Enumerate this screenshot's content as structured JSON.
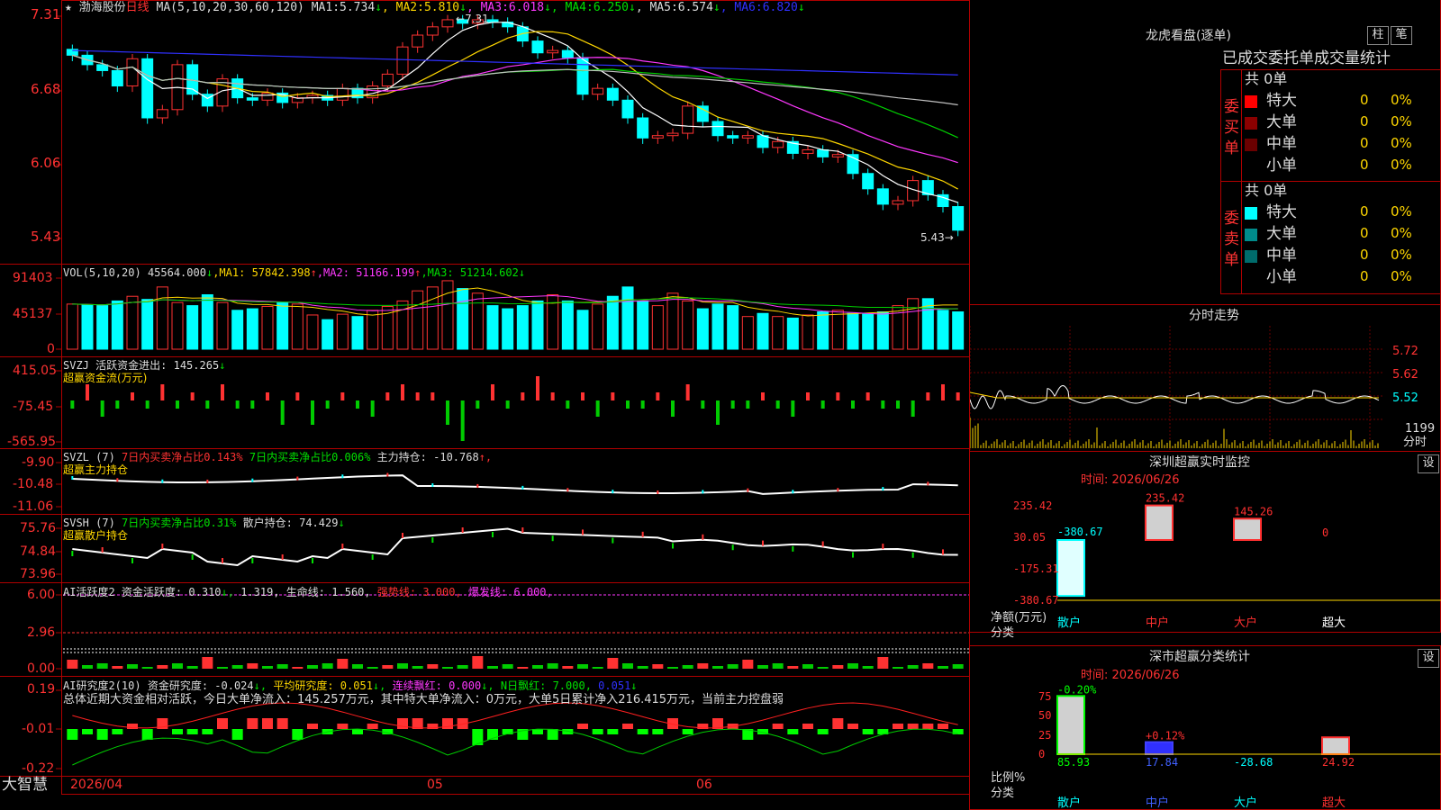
{
  "colors": {
    "up": "#ff3232",
    "down": "#00ffff",
    "ma1": "#ffffff",
    "ma2": "#ffd700",
    "ma3": "#ff38ff",
    "ma4": "#00d000",
    "ma5": "#c0c0c0",
    "ma6": "#3030ff",
    "grid": "#b00000",
    "bg": "#000000"
  },
  "title": {
    "star": "★",
    "name": "渤海股份",
    "period": "日线",
    "ma_label": "MA(5,10,20,30,60,120)",
    "ma": [
      {
        "k": "MA1:",
        "v": "5.734",
        "a": "↓"
      },
      {
        "k": "MA2:",
        "v": "5.810",
        "a": "↓"
      },
      {
        "k": "MA3:",
        "v": "6.018",
        "a": "↓"
      },
      {
        "k": "MA4:",
        "v": "6.250",
        "a": "↓"
      },
      {
        "k": "MA5:",
        "v": "6.574",
        "a": "↓"
      },
      {
        "k": "MA6:",
        "v": "6.820",
        "a": "↓"
      }
    ]
  },
  "price_axis": [
    "7.31",
    "6.68",
    "6.06",
    "5.43"
  ],
  "price_marks": {
    "high": "7.31",
    "low": "5.43"
  },
  "vol": {
    "label": "VOL(5,10,20)",
    "v": "45564.000",
    "a": "↓",
    "ma1": "57842.398",
    "ma2": "51166.199",
    "ma3": "51214.602",
    "axis": [
      "91403",
      "45137",
      "0"
    ]
  },
  "svzj": {
    "label": "SVZJ",
    "name": "活跃资金进出:",
    "v": "145.265",
    "a": "↓",
    "sub": "超赢资金流(万元)",
    "axis": [
      "415.05",
      "-75.45",
      "-565.95"
    ]
  },
  "svzl": {
    "label": "SVZL (7)",
    "t1": "7日内买卖净占比0.143%",
    "t2": "7日内买卖净占比0.006%",
    "t3": "主力持仓:",
    "v": "-10.768",
    "a": "↑,",
    "sub": "超赢主力持仓",
    "axis": [
      "-9.90",
      "-10.48",
      "-11.06"
    ]
  },
  "svsh": {
    "label": "SVSH (7)",
    "t1": "7日内买卖净占比0.31%",
    "t3": "散户持仓:",
    "v": "74.429",
    "a": "↓",
    "sub": "超赢散户持仓",
    "axis": [
      "75.76",
      "74.84",
      "73.96"
    ]
  },
  "ai1": {
    "label": "AI活跃度2",
    "t1": "资金活跃度:",
    "v1": "0.310",
    "a1": "↓,",
    "v2": "1.319,",
    "t2": "生命线:",
    "v3": "1.560,",
    "t3": "强势线:",
    "v4": "3.000,",
    "t4": "爆发线:",
    "v5": "6.000,",
    "axis": [
      "6.00",
      "2.96",
      "0.00"
    ]
  },
  "ai2": {
    "label": "AI研究度2(10)",
    "t1": "资金研究度:",
    "v1": "-0.024",
    "a1": "↓,",
    "t2": "平均研究度:",
    "v2": "0.051",
    "a2": "↓,",
    "t3": "连续飘红:",
    "v3": "0.000",
    "a3": "↓,",
    "t4": "N日飘红:",
    "v4": "7.000,",
    "v5": "0.051",
    "a5": "↓",
    "summary": "总体近期大资金相对活跃，今日大单净流入：145.257万元，其中特大单净流入：0万元，大单5日累计净入216.415万元，当前主力控盘弱",
    "axis": [
      "0.19",
      "-0.01",
      "-0.22"
    ]
  },
  "xaxis": [
    "2026/04",
    "05",
    "06"
  ],
  "brand": "大智慧",
  "dragon": {
    "title": "龙虎看盘(逐单)",
    "btn1": "柱",
    "btn2": "笔",
    "subtitle": "已成交委托单成交量统计",
    "buy": {
      "side": "委买单",
      "total": "共 0单",
      "rows": [
        {
          "n": "特大",
          "v": "0",
          "p": "0%",
          "c": "#ff0000"
        },
        {
          "n": "大单",
          "v": "0",
          "p": "0%",
          "c": "#8b0000"
        },
        {
          "n": "中单",
          "v": "0",
          "p": "0%",
          "c": "#6b0000"
        },
        {
          "n": "小单",
          "v": "0",
          "p": "0%",
          "c": "#000000"
        }
      ]
    },
    "sell": {
      "side": "委卖单",
      "total": "共 0单",
      "rows": [
        {
          "n": "特大",
          "v": "0",
          "p": "0%",
          "c": "#00ffff"
        },
        {
          "n": "大单",
          "v": "0",
          "p": "0%",
          "c": "#008b8b"
        },
        {
          "n": "中单",
          "v": "0",
          "p": "0%",
          "c": "#006b6b"
        },
        {
          "n": "小单",
          "v": "0",
          "p": "0%",
          "c": "#000000"
        }
      ]
    }
  },
  "intraday": {
    "title": "分时走势",
    "axis": [
      "5.72",
      "5.62",
      "5.52"
    ],
    "vol_max": "1199",
    "vol_unit": "分时"
  },
  "sz_monitor": {
    "title": "深圳超赢实时监控",
    "btn": "设",
    "date_label": "时间:",
    "date": "2026/06/26",
    "yaxis": [
      "235.42",
      "30.05",
      "-175.31",
      "-380.67"
    ],
    "ylabel1": "净额(万元)",
    "ylabel2": "分类",
    "cats": [
      "散户",
      "中户",
      "大户",
      "超大"
    ],
    "values": [
      -380.67,
      235.42,
      145.26,
      0
    ],
    "value_labels": [
      "-380.67",
      "235.42",
      "145.26",
      "0"
    ]
  },
  "sz_class": {
    "title": "深市超赢分类统计",
    "btn": "设",
    "date_label": "时间:",
    "date": "2026/06/26",
    "yaxis": [
      "75",
      "50",
      "25",
      "0"
    ],
    "ylabel1": "比例%",
    "ylabel2": "分类",
    "cats": [
      "散户",
      "中户",
      "大户",
      "超大"
    ],
    "pct_labels": [
      "-0.20%",
      "+0.12%",
      "",
      ""
    ],
    "values": [
      85.93,
      17.84,
      -28.68,
      24.92
    ],
    "value_labels": [
      "85.93",
      "17.84",
      "-28.68",
      "24.92"
    ]
  },
  "chart_data": {
    "type": "bar",
    "title": "渤海股份 日线",
    "candles_close": [
      6.98,
      6.9,
      6.85,
      6.72,
      6.95,
      6.45,
      6.52,
      6.9,
      6.65,
      6.55,
      6.78,
      6.62,
      6.6,
      6.66,
      6.58,
      6.62,
      6.64,
      6.6,
      6.7,
      6.62,
      6.72,
      6.82,
      7.05,
      7.15,
      7.22,
      7.28,
      7.25,
      7.28,
      7.26,
      7.22,
      7.1,
      7.0,
      7.02,
      6.96,
      6.65,
      6.7,
      6.6,
      6.45,
      6.28,
      6.3,
      6.32,
      6.55,
      6.42,
      6.3,
      6.28,
      6.3,
      6.2,
      6.25,
      6.15,
      6.18,
      6.12,
      6.14,
      5.98,
      5.85,
      5.72,
      5.75,
      5.92,
      5.8,
      5.7,
      5.5
    ],
    "volume": [
      58,
      57,
      56,
      62,
      68,
      64,
      80,
      60,
      56,
      70,
      60,
      50,
      52,
      55,
      60,
      58,
      44,
      38,
      45,
      42,
      50,
      55,
      62,
      75,
      80,
      88,
      78,
      72,
      56,
      52,
      56,
      62,
      70,
      62,
      50,
      58,
      68,
      80,
      62,
      56,
      72,
      62,
      52,
      58,
      56,
      42,
      46,
      42,
      40,
      44,
      48,
      50,
      46,
      45,
      48,
      56,
      65,
      65,
      50,
      48
    ]
  }
}
